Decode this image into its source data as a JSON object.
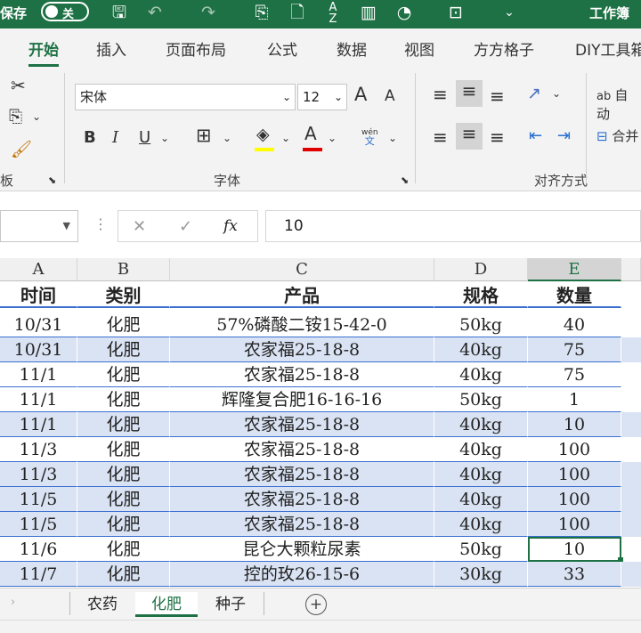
{
  "titlebar": {
    "autosave_label": "保存",
    "toggle_label": "关",
    "workbook_label": "工作簿",
    "icons": [
      "save-icon",
      "undo-icon",
      "redo-icon",
      "form-icon",
      "new-doc-icon",
      "sort-az-icon",
      "chart-icon",
      "shapes-icon",
      "textbox-icon",
      "more-icon"
    ]
  },
  "ribbon_tabs": [
    "开始",
    "插入",
    "页面布局",
    "公式",
    "数据",
    "视图",
    "方方格子",
    "DIY工具箱"
  ],
  "active_tab": "开始",
  "ribbon": {
    "clipboard_label": "板",
    "font_group_label": "字体",
    "align_group_label": "对齐方式",
    "font_name": "宋体",
    "font_size": "12",
    "grow_font": "A",
    "shrink_font": "A",
    "bold": "B",
    "italic": "I",
    "underline": "U",
    "font_color_letter": "A",
    "phonetic_top": "wén",
    "phonetic_bottom": "文",
    "wrap_text": "自动",
    "merge": "合并",
    "wrap_icon_text": "ab",
    "highlight_color": "#ffff00",
    "font_color": "#e00000"
  },
  "formula_bar": {
    "name_box": "",
    "fx_label": "fx",
    "value": "10"
  },
  "columns": [
    "A",
    "B",
    "C",
    "D",
    "E"
  ],
  "selected_column": "E",
  "header_row": [
    "时间",
    "类别",
    "产品",
    "规格",
    "数量"
  ],
  "rows": [
    [
      "10/31",
      "化肥",
      "57%磷酸二铵15-42-0",
      "50kg",
      "40"
    ],
    [
      "10/31",
      "化肥",
      "农家福25-18-8",
      "40kg",
      "75"
    ],
    [
      "11/1",
      "化肥",
      "农家福25-18-8",
      "40kg",
      "75"
    ],
    [
      "11/1",
      "化肥",
      "辉隆复合肥16-16-16",
      "50kg",
      "1"
    ],
    [
      "11/1",
      "化肥",
      "农家福25-18-8",
      "40kg",
      "10"
    ],
    [
      "11/3",
      "化肥",
      "农家福25-18-8",
      "40kg",
      "100"
    ],
    [
      "11/3",
      "化肥",
      "农家福25-18-8",
      "40kg",
      "100"
    ],
    [
      "11/5",
      "化肥",
      "农家福25-18-8",
      "40kg",
      "100"
    ],
    [
      "11/5",
      "化肥",
      "农家福25-18-8",
      "40kg",
      "100"
    ],
    [
      "11/6",
      "化肥",
      "昆仑大颗粒尿素",
      "50kg",
      "10"
    ],
    [
      "11/7",
      "化肥",
      "控的玫26-15-6",
      "30kg",
      "33"
    ]
  ],
  "sheet_tabs": [
    "农药",
    "化肥",
    "种子"
  ],
  "active_sheet": "化肥",
  "colors": {
    "accent": "#1e7145",
    "band": "#dae3f3",
    "table_border": "#3a6fd0"
  }
}
